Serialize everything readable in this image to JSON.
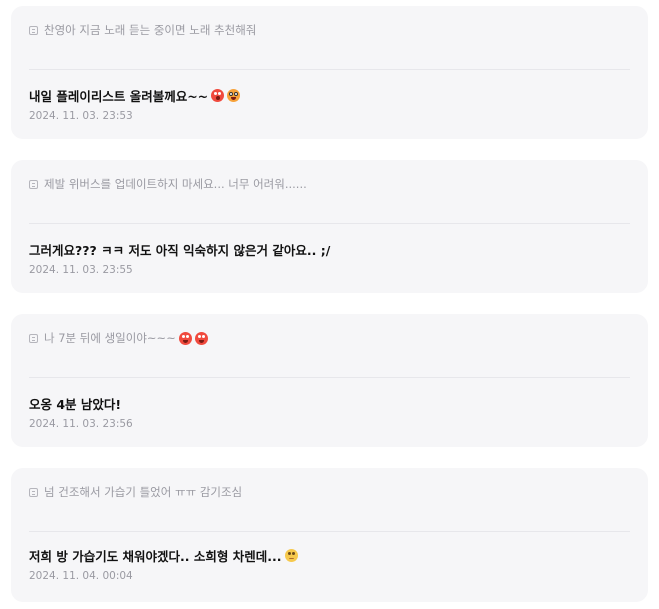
{
  "posts": [
    {
      "quote": "찬영아 지금 노래 듣는 중이면 노래 추천해줘",
      "reply": "내일 플레이리스트 올려볼께요~~",
      "emojis": [
        "surprised-face-icon",
        "face-with-glasses-icon"
      ],
      "timestamp": "2024. 11. 03. 23:53"
    },
    {
      "quote": "제발 위버스를 업데이트하지 마세요... 너무 어려워......",
      "reply": "그러게요??? ㅋㅋ 저도 아직 익숙하지 않은거 같아요.. ;/",
      "emojis": [],
      "timestamp": "2024. 11. 03. 23:55"
    },
    {
      "quote": "나 7분 뒤에 생일이야~~~",
      "quote_emojis": [
        "laughing-face-icon",
        "laughing-face-icon"
      ],
      "reply": "오옹 4분 남았다!",
      "emojis": [],
      "timestamp": "2024. 11. 03. 23:56"
    },
    {
      "quote": "넘 건조해서 가습기 틀었어 ㅠㅠ 감기조심",
      "reply": "저희 방 가습기도 채워야겠다.. 소희형 차렌데...",
      "emojis": [
        "thinking-face-icon"
      ],
      "timestamp": "2024. 11. 04. 00:04"
    }
  ]
}
